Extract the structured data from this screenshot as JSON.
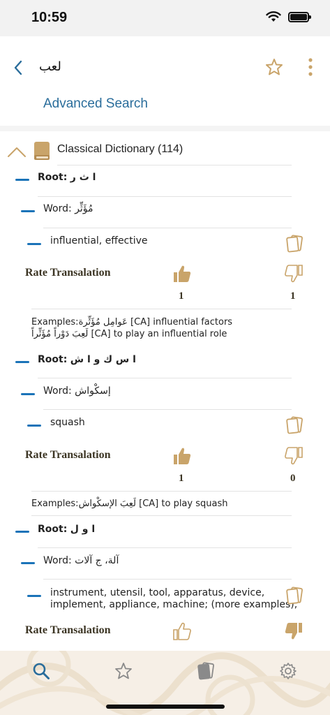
{
  "status": {
    "time": "10:59"
  },
  "header": {
    "search_term": "لعب",
    "advanced_search": "Advanced Search"
  },
  "dictionary": {
    "title": "Classical Dictionary (114)"
  },
  "entries": [
    {
      "root_prefix": "Root:",
      "root": "ا ث ر",
      "word_prefix": "Word:",
      "word": "مُؤَثِّر",
      "translation": "influential, effective",
      "rate_label": "Rate Transalation",
      "likes": "1",
      "dislikes": "1",
      "examples": [
        {
          "ar": "عَوامِل مُؤَثِّرة",
          "en": "[CA] influential factors"
        },
        {
          "ar": "لَعِبَ دَوْراً مُؤَثِّراً",
          "en": "[CA] to play an influential role"
        }
      ]
    },
    {
      "root_prefix": "Root:",
      "root": "ا س ك و ا ش",
      "word_prefix": "Word:",
      "word": "إسكْواش",
      "translation": "squash",
      "rate_label": "Rate Transalation",
      "likes": "1",
      "dislikes": "0",
      "examples": [
        {
          "ar": "لَعِبَ الإسكْواش",
          "en": "[CA] to play squash"
        }
      ]
    },
    {
      "root_prefix": "Root:",
      "root": "ا و ل",
      "word_prefix": "Word:",
      "word": "آلة، ج آلات",
      "translation_line1": "instrument, utensil, tool, apparatus, device,",
      "translation_line2": "implement, appliance, machine; (more examples);",
      "rate_label": "Rate Transalation"
    }
  ],
  "examples_label": "Examples:",
  "colors": {
    "accent_blue": "#1b73b8",
    "link_blue": "#2a6d9b",
    "gold": "#c9a46a",
    "tan_bg": "#f6efe6"
  },
  "tabs": [
    "search-icon",
    "star-icon",
    "cards-icon",
    "gear-icon"
  ]
}
